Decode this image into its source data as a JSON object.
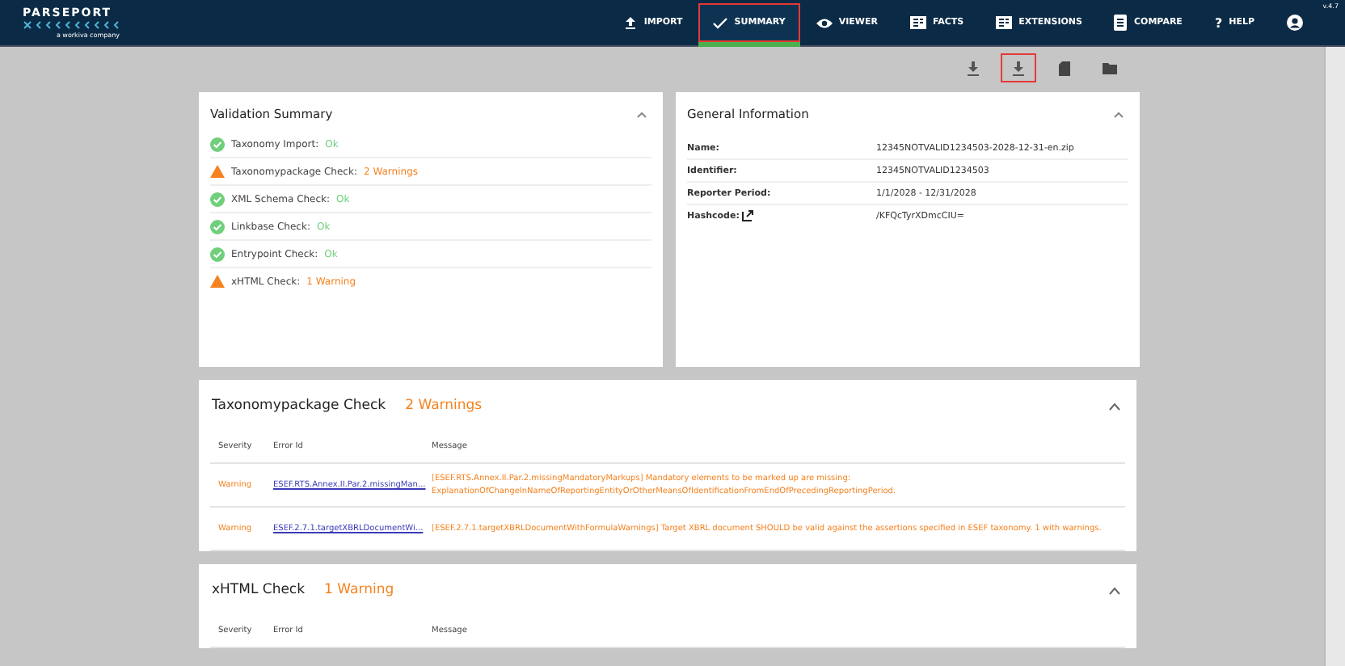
{
  "header": {
    "logo": "PARSEPORT",
    "logo_tagline": "a workiva company",
    "version": "v.4.7",
    "nav": [
      {
        "label": "IMPORT",
        "kind": "upload",
        "selected": false,
        "highlighted": false
      },
      {
        "label": "SUMMARY",
        "kind": "check",
        "selected": true,
        "highlighted": true
      },
      {
        "label": "VIEWER",
        "kind": "eye",
        "selected": false,
        "highlighted": false
      },
      {
        "label": "FACTS",
        "kind": "grid",
        "selected": false,
        "highlighted": false
      },
      {
        "label": "EXTENSIONS",
        "kind": "grid",
        "selected": false,
        "highlighted": false
      },
      {
        "label": "COMPARE",
        "kind": "doc",
        "selected": false,
        "highlighted": false
      },
      {
        "label": "HELP",
        "kind": "question",
        "glyph": "?",
        "selected": false,
        "highlighted": false
      },
      {
        "kind": "user",
        "selected": false,
        "highlighted": false
      }
    ]
  },
  "toolbar": [
    {
      "kind": "download",
      "highlighted": false
    },
    {
      "kind": "download",
      "highlighted": true
    },
    {
      "kind": "file",
      "highlighted": false
    },
    {
      "kind": "folder",
      "highlighted": false
    }
  ],
  "validation_summary": {
    "title": "Validation Summary",
    "items": [
      {
        "label": "Taxonomy Import:",
        "status": "Ok",
        "kind": "ok"
      },
      {
        "label": "Taxonomypackage Check:",
        "status": "2 Warnings",
        "kind": "warning"
      },
      {
        "label": "XML Schema Check:",
        "status": "Ok",
        "kind": "ok"
      },
      {
        "label": "Linkbase Check:",
        "status": "Ok",
        "kind": "ok"
      },
      {
        "label": "Entrypoint Check:",
        "status": "Ok",
        "kind": "ok"
      },
      {
        "label": "xHTML Check:",
        "status": "1 Warning",
        "kind": "warning"
      }
    ]
  },
  "general_information": {
    "title": "General Information",
    "rows": [
      {
        "label": "Name:",
        "value": "12345NOTVALID1234503-2028-12-31-en.zip",
        "link": false
      },
      {
        "label": "Identifier:",
        "value": "12345NOTVALID1234503",
        "link": false
      },
      {
        "label": "Reporter Period:",
        "value": "1/1/2028 - 12/31/2028",
        "link": false
      },
      {
        "label": "Hashcode:",
        "value": "/KFQcTyrXDmcCIU=",
        "link": true
      }
    ]
  },
  "checks": [
    {
      "title": "Taxonomypackage Check",
      "count": "2 Warnings",
      "columns": [
        "Severity",
        "Error Id",
        "Message"
      ],
      "rows": [
        {
          "severity": "Warning",
          "error_id": "ESEF.RTS.Annex.II.Par.2.missingMan...",
          "message": "[ESEF.RTS.Annex.II.Par.2.missingMandatoryMarkups] Mandatory elements to be marked up are missing: ExplanationOfChangeInNameOfReportingEntityOrOtherMeansOfIdentificationFromEndOfPrecedingReportingPeriod."
        },
        {
          "severity": "Warning",
          "error_id": "ESEF.2.7.1.targetXBRLDocumentWi...",
          "message": "[ESEF.2.7.1.targetXBRLDocumentWithFormulaWarnings] Target XBRL document SHOULD be valid against the assertions specified in ESEF taxonomy. 1 with warnings."
        }
      ]
    },
    {
      "title": "xHTML Check",
      "count": "1 Warning",
      "columns": [
        "Severity",
        "Error Id",
        "Message"
      ]
    }
  ]
}
